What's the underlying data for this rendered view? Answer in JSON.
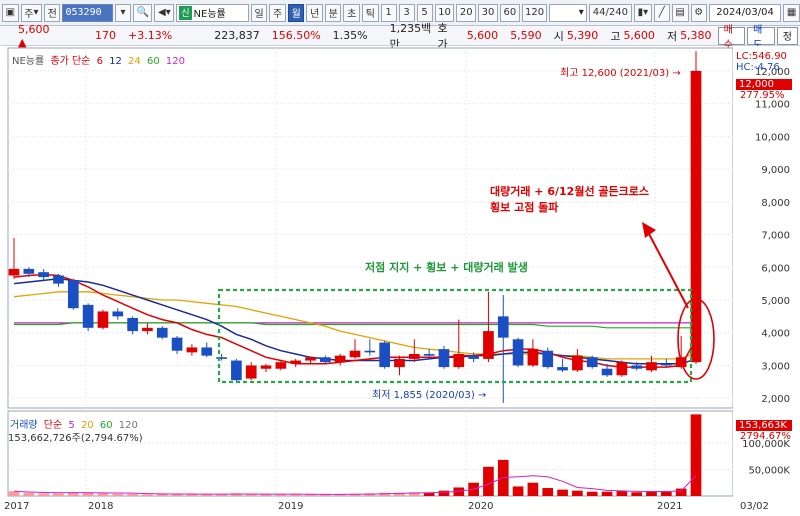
{
  "toolbar": {
    "type_label": "주",
    "all_label": "전",
    "code": "053290",
    "shin_label": "신",
    "stock_name": "NE능률",
    "tabs": [
      "일",
      "주",
      "월",
      "년",
      "분",
      "초",
      "틱"
    ],
    "active_tab": "월",
    "intervals": [
      "1",
      "3",
      "5",
      "10",
      "20",
      "30",
      "60",
      "120"
    ],
    "count": "44/240",
    "date": "2024/03/04"
  },
  "quote": {
    "price": "5,600",
    "change": "170",
    "change_pct": "+3.13%",
    "volume": "223,837",
    "vol_ratio": "156.50%",
    "turnover": "1.35%",
    "amount": "1,235백만",
    "hoga_label": "호가",
    "ask": "5,600",
    "bid": "5,590",
    "open_label": "시",
    "open": "5,390",
    "high_label": "고",
    "high": "5,600",
    "low_label": "저",
    "low": "5,380",
    "buy_label": "매수",
    "sell_label": "매도",
    "jeong_label": "정"
  },
  "legend": {
    "stock": "NE능률",
    "ma_prefix": "종가 단순",
    "ma": [
      "6",
      "12",
      "24",
      "60",
      "120"
    ],
    "vol_label": "거래량",
    "vol_prefix": "단순",
    "vol_ma": [
      "5",
      "20",
      "60",
      "120"
    ],
    "vol_value": "153,662,726주(2,794.67%)"
  },
  "annotations": {
    "high_label": "최고 12,600 (2021/03)",
    "low_label": "최저 1,855 (2020/03)",
    "box_label": "저점 지지 + 횡보 + 대량거래 발생",
    "breakout_line1": "대량거래 + 6/12월선 골든크로스",
    "breakout_line2": "횡보 고점 돌파",
    "lc_label": "LC:546.90",
    "hc_label": "HC:-4.76",
    "price_tag": "12,000",
    "pct_tag": "277.95%",
    "vol_tag": "153,663K",
    "vol_pct_tag": "2794.67%",
    "arrow_right": "→"
  },
  "colors": {
    "up": "#e00000",
    "down": "#1a4fc4",
    "ma6": "#e00000",
    "ma12": "#1a2a9a",
    "ma24": "#e6a000",
    "ma60": "#22aa22",
    "ma120": "#cc22cc",
    "box": "#22aa44",
    "annotation": "#e00000"
  },
  "chart_data": {
    "type": "candlestick",
    "y_ticks": [
      "12,000",
      "11,000",
      "10,000",
      "9,000",
      "8,000",
      "7,000",
      "6,000",
      "5,000",
      "4,000",
      "3,000",
      "2,000"
    ],
    "y_values": [
      12000,
      11000,
      10000,
      9000,
      8000,
      7000,
      6000,
      5000,
      4000,
      3000,
      2000
    ],
    "ylim": [
      1700,
      12700
    ],
    "x_labels": [
      "2017",
      "2018",
      "2019",
      "2020",
      "2021",
      "03/02"
    ],
    "candles": [
      {
        "o": 5750,
        "c": 5950,
        "h": 6900,
        "l": 5650
      },
      {
        "o": 5950,
        "c": 5800,
        "h": 6000,
        "l": 5700
      },
      {
        "o": 5850,
        "c": 5700,
        "h": 5950,
        "l": 5600
      },
      {
        "o": 5750,
        "c": 5500,
        "h": 5800,
        "l": 5400
      },
      {
        "o": 5600,
        "c": 4750,
        "h": 5650,
        "l": 4700
      },
      {
        "o": 4850,
        "c": 4150,
        "h": 4900,
        "l": 4050
      },
      {
        "o": 4150,
        "c": 4650,
        "h": 4700,
        "l": 4100
      },
      {
        "o": 4650,
        "c": 4500,
        "h": 4750,
        "l": 4400
      },
      {
        "o": 4450,
        "c": 4050,
        "h": 4500,
        "l": 3950
      },
      {
        "o": 4050,
        "c": 4150,
        "h": 4300,
        "l": 3950
      },
      {
        "o": 4150,
        "c": 3850,
        "h": 4200,
        "l": 3800
      },
      {
        "o": 3850,
        "c": 3450,
        "h": 3900,
        "l": 3350
      },
      {
        "o": 3400,
        "c": 3550,
        "h": 3650,
        "l": 3300
      },
      {
        "o": 3550,
        "c": 3300,
        "h": 3700,
        "l": 3250
      },
      {
        "o": 3250,
        "c": 3200,
        "h": 3350,
        "l": 3150
      },
      {
        "o": 3150,
        "c": 2550,
        "h": 3200,
        "l": 2500
      },
      {
        "o": 2600,
        "c": 3000,
        "h": 3100,
        "l": 2550
      },
      {
        "o": 2900,
        "c": 3000,
        "h": 3050,
        "l": 2800
      },
      {
        "o": 2900,
        "c": 3100,
        "h": 3150,
        "l": 2850
      },
      {
        "o": 3050,
        "c": 3150,
        "h": 3200,
        "l": 2950
      },
      {
        "o": 3150,
        "c": 3250,
        "h": 3250,
        "l": 3050
      },
      {
        "o": 3250,
        "c": 3100,
        "h": 3300,
        "l": 3050
      },
      {
        "o": 3100,
        "c": 3300,
        "h": 3350,
        "l": 3000
      },
      {
        "o": 3250,
        "c": 3450,
        "h": 3800,
        "l": 3200
      },
      {
        "o": 3450,
        "c": 3400,
        "h": 3800,
        "l": 3300
      },
      {
        "o": 3700,
        "c": 2950,
        "h": 3750,
        "l": 2900
      },
      {
        "o": 2950,
        "c": 3200,
        "h": 3300,
        "l": 2700
      },
      {
        "o": 3200,
        "c": 3350,
        "h": 3800,
        "l": 3100
      },
      {
        "o": 3350,
        "c": 3300,
        "h": 3500,
        "l": 3200
      },
      {
        "o": 3500,
        "c": 2950,
        "h": 3600,
        "l": 2900
      },
      {
        "o": 2950,
        "c": 3350,
        "h": 4400,
        "l": 2900
      },
      {
        "o": 3300,
        "c": 3200,
        "h": 3400,
        "l": 3100
      },
      {
        "o": 3200,
        "c": 4050,
        "h": 5250,
        "l": 3100
      },
      {
        "o": 4500,
        "c": 3850,
        "h": 5150,
        "l": 1855
      },
      {
        "o": 3800,
        "c": 3000,
        "h": 3850,
        "l": 2950
      },
      {
        "o": 3000,
        "c": 3500,
        "h": 3800,
        "l": 2950
      },
      {
        "o": 3450,
        "c": 2950,
        "h": 3550,
        "l": 2900
      },
      {
        "o": 2950,
        "c": 2850,
        "h": 3200,
        "l": 2800
      },
      {
        "o": 2850,
        "c": 3300,
        "h": 3500,
        "l": 2800
      },
      {
        "o": 3250,
        "c": 2950,
        "h": 3300,
        "l": 2900
      },
      {
        "o": 2900,
        "c": 2700,
        "h": 3050,
        "l": 2650
      },
      {
        "o": 2700,
        "c": 3100,
        "h": 3150,
        "l": 2650
      },
      {
        "o": 3000,
        "c": 2900,
        "h": 3100,
        "l": 2850
      },
      {
        "o": 2850,
        "c": 3100,
        "h": 3300,
        "l": 2800
      },
      {
        "o": 3050,
        "c": 3000,
        "h": 3200,
        "l": 2950
      },
      {
        "o": 2950,
        "c": 3250,
        "h": 3900,
        "l": 2900
      },
      {
        "o": 3100,
        "c": 12000,
        "h": 12600,
        "l": 3050
      }
    ],
    "ma6": [
      5700,
      5750,
      5780,
      5750,
      5600,
      5400,
      5150,
      4950,
      4750,
      4550,
      4400,
      4300,
      4100,
      3950,
      3850,
      3650,
      3450,
      3250,
      3150,
      3050,
      3050,
      3050,
      3100,
      3150,
      3200,
      3250,
      3250,
      3250,
      3250,
      3250,
      3300,
      3300,
      3350,
      3450,
      3500,
      3500,
      3400,
      3250,
      3150,
      3100,
      3000,
      2950,
      2950,
      2950,
      2950,
      3000,
      3800
    ],
    "ma12": [
      5500,
      5550,
      5600,
      5650,
      5600,
      5550,
      5450,
      5300,
      5150,
      5000,
      4850,
      4700,
      4550,
      4400,
      4200,
      3950,
      3800,
      3600,
      3450,
      3350,
      3250,
      3200,
      3150,
      3150,
      3150,
      3150,
      3150,
      3150,
      3200,
      3250,
      3250,
      3300,
      3300,
      3350,
      3400,
      3400,
      3350,
      3300,
      3250,
      3200,
      3150,
      3100,
      3050,
      3050,
      3050,
      3050,
      3200
    ],
    "ma24": [
      5100,
      5150,
      5200,
      5250,
      5250,
      5250,
      5200,
      5150,
      5100,
      5050,
      5000,
      5000,
      4950,
      4900,
      4850,
      4800,
      4700,
      4600,
      4500,
      4400,
      4300,
      4200,
      4050,
      3950,
      3850,
      3750,
      3650,
      3550,
      3500,
      3450,
      3400,
      3350,
      3350,
      3350,
      3350,
      3350,
      3350,
      3300,
      3300,
      3250,
      3200,
      3200,
      3200,
      3200,
      3200,
      3200,
      3400
    ],
    "ma60": [
      4250,
      4250,
      4250,
      4250,
      4300,
      4300,
      4300,
      4300,
      4300,
      4300,
      4300,
      4300,
      4300,
      4300,
      4300,
      4300,
      4300,
      4250,
      4250,
      4250,
      4250,
      4250,
      4250,
      4250,
      4250,
      4250,
      4250,
      4250,
      4250,
      4250,
      4250,
      4250,
      4250,
      4250,
      4250,
      4250,
      4200,
      4200,
      4200,
      4200,
      4150,
      4150,
      4150,
      4150,
      4150,
      4150,
      4150
    ],
    "ma120": [
      4300,
      4300,
      4300,
      4300,
      4300,
      4300,
      4300,
      4300,
      4300,
      4300,
      4300,
      4300,
      4300,
      4300,
      4300,
      4300,
      4300,
      4300,
      4300,
      4300,
      4300,
      4300,
      4300,
      4300,
      4300,
      4300,
      4300,
      4300,
      4300,
      4300,
      4300,
      4300,
      4300,
      4300,
      4300,
      4300,
      4300,
      4300,
      4300,
      4300,
      4300,
      4300,
      4300,
      4300,
      4300,
      4300,
      4300
    ],
    "volume": {
      "y_ticks": [
        "100,000K",
        "50,000K"
      ],
      "y_values": [
        100000,
        50000
      ],
      "ylim": [
        0,
        160000
      ],
      "values": [
        9000,
        6000,
        5000,
        5000,
        7000,
        7000,
        5000,
        4000,
        4000,
        3000,
        4000,
        4000,
        4000,
        3000,
        3000,
        5000,
        4000,
        3000,
        3000,
        3000,
        3000,
        3000,
        3000,
        4000,
        5000,
        6000,
        6000,
        7000,
        6000,
        10000,
        16000,
        25000,
        55000,
        68000,
        18000,
        25000,
        15000,
        12000,
        10000,
        8000,
        8000,
        10000,
        7000,
        9000,
        8000,
        14000,
        153663
      ]
    }
  }
}
